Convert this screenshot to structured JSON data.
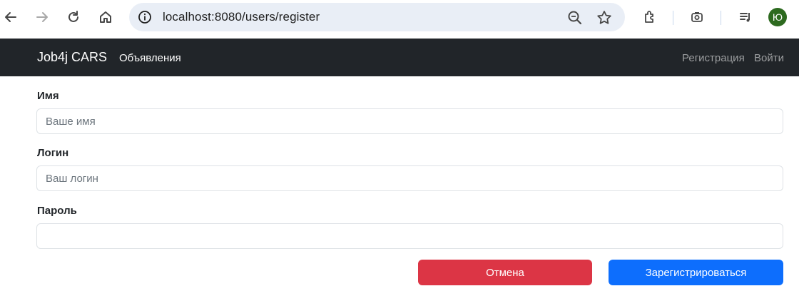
{
  "browser": {
    "url": "localhost:8080/users/register",
    "profile_initial": "Ю",
    "icons": [
      "back-arrow-icon",
      "forward-arrow-icon",
      "reload-icon",
      "home-icon",
      "site-info-icon",
      "zoom-icon",
      "bookmark-star-icon",
      "extensions-icon",
      "google-lens-icon",
      "media-queue-icon"
    ]
  },
  "navbar": {
    "brand": "Job4j CARS",
    "links": {
      "ads": "Объявления"
    },
    "right": {
      "register": "Регистрация",
      "login": "Войти"
    }
  },
  "form": {
    "name": {
      "label": "Имя",
      "placeholder": "Ваше имя"
    },
    "login": {
      "label": "Логин",
      "placeholder": "Ваш логин"
    },
    "password": {
      "label": "Пароль",
      "placeholder": ""
    },
    "cancel_label": "Отмена",
    "submit_label": "Зарегистрироваться"
  },
  "colors": {
    "navbar_bg": "#212529",
    "cancel": "#dc3545",
    "submit": "#0d6efd",
    "omnibox": "#e9eef6"
  }
}
